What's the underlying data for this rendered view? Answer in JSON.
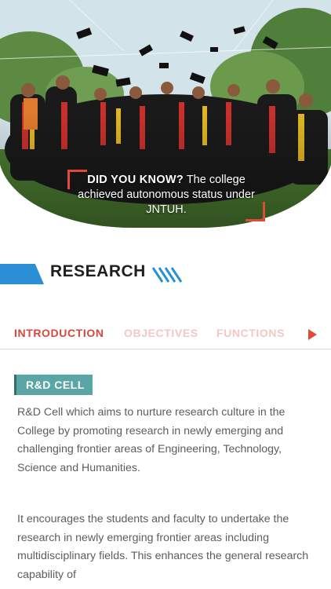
{
  "hero": {
    "fact_prefix": "DID YOU KNOW?",
    "fact_text": " The college achieved autonomous status under JNTUH.",
    "image_subject": "graduation-cap-toss-photo"
  },
  "section": {
    "title": "RESEARCH",
    "accent_color": "#2b8fd6"
  },
  "tabs": [
    {
      "label": "INTRODUCTION",
      "active": true
    },
    {
      "label": "OBJECTIVES",
      "active": false
    },
    {
      "label": "FUNCTIONS",
      "active": false
    }
  ],
  "tab_next_icon": "play-right-icon",
  "content": {
    "label": "R&D CELL",
    "paragraphs": [
      "R&D Cell which aims to nurture research culture in the College by promoting research in newly emerging and challenging frontier areas of Engineering, Technology, Science and Humanities.",
      "It encourages the students and faculty to undertake the research in newly emerging frontier areas including multidisciplinary fields. This enhances the general research capability of"
    ]
  },
  "colors": {
    "tab_active": "#d9473c",
    "tab_inactive": "#f3c7c3",
    "label_bg": "#5aa6a6",
    "corner_accent": "#e04a3a"
  }
}
